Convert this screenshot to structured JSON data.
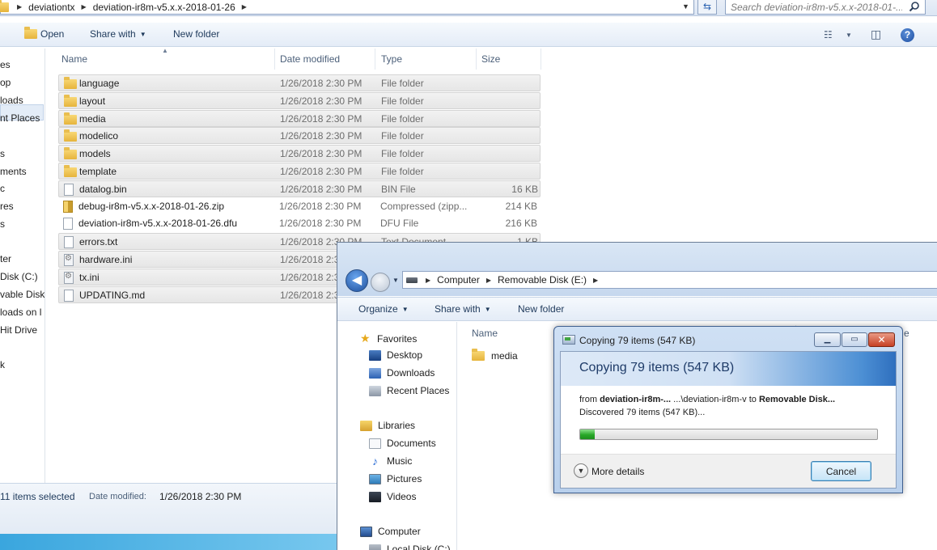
{
  "win1": {
    "breadcrumb": [
      "deviationtx",
      "deviation-ir8m-v5.x.x-2018-01-26"
    ],
    "search_placeholder": "Search deviation-ir8m-v5.x.x-2018-01-...",
    "toolbar": {
      "open": "Open",
      "share": "Share with",
      "new_folder": "New folder"
    },
    "nav": [
      "es",
      "op",
      "loads",
      "nt Places",
      "s",
      "ments",
      "c",
      "res",
      "s",
      "ter",
      "Disk (C:)",
      "vable Disk",
      "loads on l",
      "Hit Drive",
      "k"
    ],
    "columns": {
      "name": "Name",
      "date": "Date modified",
      "type": "Type",
      "size": "Size"
    },
    "files": [
      {
        "name": "language",
        "date": "1/26/2018 2:30 PM",
        "type": "File folder",
        "size": ""
      },
      {
        "name": "layout",
        "date": "1/26/2018 2:30 PM",
        "type": "File folder",
        "size": ""
      },
      {
        "name": "media",
        "date": "1/26/2018 2:30 PM",
        "type": "File folder",
        "size": ""
      },
      {
        "name": "modelico",
        "date": "1/26/2018 2:30 PM",
        "type": "File folder",
        "size": ""
      },
      {
        "name": "models",
        "date": "1/26/2018 2:30 PM",
        "type": "File folder",
        "size": ""
      },
      {
        "name": "template",
        "date": "1/26/2018 2:30 PM",
        "type": "File folder",
        "size": ""
      },
      {
        "name": "datalog.bin",
        "date": "1/26/2018 2:30 PM",
        "type": "BIN File",
        "size": "16 KB"
      },
      {
        "name": "debug-ir8m-v5.x.x-2018-01-26.zip",
        "date": "1/26/2018 2:30 PM",
        "type": "Compressed (zipp...",
        "size": "214 KB"
      },
      {
        "name": "deviation-ir8m-v5.x.x-2018-01-26.dfu",
        "date": "1/26/2018 2:30 PM",
        "type": "DFU File",
        "size": "216 KB"
      },
      {
        "name": "errors.txt",
        "date": "1/26/2018 2:30 PM",
        "type": "Text Document",
        "size": "1 KB"
      },
      {
        "name": "hardware.ini",
        "date": "1/26/2018 2:3",
        "type": "",
        "size": ""
      },
      {
        "name": "tx.ini",
        "date": "1/26/2018 2:3",
        "type": "",
        "size": ""
      },
      {
        "name": "UPDATING.md",
        "date": "1/26/2018 2:3",
        "type": "",
        "size": ""
      }
    ],
    "status": {
      "selected": "11 items selected",
      "date_label": "Date modified:",
      "date_value": "1/26/2018 2:30 PM"
    }
  },
  "win2": {
    "breadcrumb": [
      "Computer",
      "Removable Disk (E:)"
    ],
    "toolbar": {
      "organize": "Organize",
      "share": "Share with",
      "new_folder": "New folder"
    },
    "favorites": "Favorites",
    "fav_items": [
      "Desktop",
      "Downloads",
      "Recent Places"
    ],
    "libraries": "Libraries",
    "lib_items": [
      "Documents",
      "Music",
      "Pictures",
      "Videos"
    ],
    "computer": "Computer",
    "computer_items": [
      "Local Disk (C:)"
    ],
    "col_name": "Name",
    "col_cut": "e",
    "files": [
      "media"
    ]
  },
  "dialog": {
    "title": "Copying 79 items (547 KB)",
    "heading": "Copying 79 items (547 KB)",
    "from_label": "from",
    "from_source": "deviation-ir8m-...",
    "from_path": " ...\\deviation-ir8m-v",
    "to_label": " to ",
    "to_dest": "Removable Disk...",
    "discovered": "Discovered 79 items (547 KB)...",
    "progress_fraction": 0.05,
    "more_details": "More details",
    "cancel": "Cancel"
  }
}
